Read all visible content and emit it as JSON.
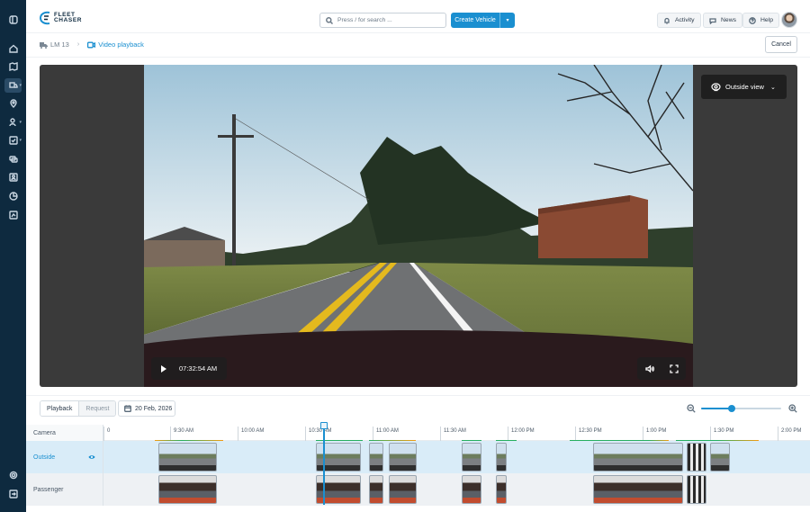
{
  "app": {
    "logo_text_line1": "FLEET",
    "logo_text_line2": "CHASER"
  },
  "rail": {
    "items": [
      "collapse-icon",
      "home-icon",
      "map-icon",
      "vehicles-icon",
      "location-icon",
      "users-icon",
      "tasks-icon",
      "messages-icon",
      "contacts-icon",
      "reports-icon",
      "compliance-icon",
      "settings-icon",
      "logout-icon"
    ]
  },
  "topbar": {
    "search_placeholder": "Press / for search ...",
    "create_label": "Create Vehicle",
    "activity_label": "Activity",
    "news_label": "News",
    "help_label": "Help"
  },
  "breadcrumb": {
    "vehicle": "LM 13",
    "page": "Video playback"
  },
  "cancel_label": "Cancel",
  "player": {
    "view_label": "Outside view",
    "time": "07:32:54 AM"
  },
  "timeline": {
    "tab_playback": "Playback",
    "tab_request": "Request",
    "date": "20 Feb, 2026",
    "zoom_level": 0.38,
    "header_label": "Camera",
    "ticks": [
      "0",
      "9:30 AM",
      "10:00 AM",
      "10:30 AM",
      "11:00 AM",
      "11:30 AM",
      "12:00 PM",
      "12:30 PM",
      "1:00 PM",
      "1:30 PM",
      "2:00 PM"
    ],
    "rows": [
      {
        "label": "Outside"
      },
      {
        "label": "Passenger"
      }
    ]
  },
  "colors": {
    "accent": "#1a8fd0",
    "rail": "#0e2a3f",
    "activity_green": "#27ae60",
    "activity_orange": "#f39c12"
  }
}
